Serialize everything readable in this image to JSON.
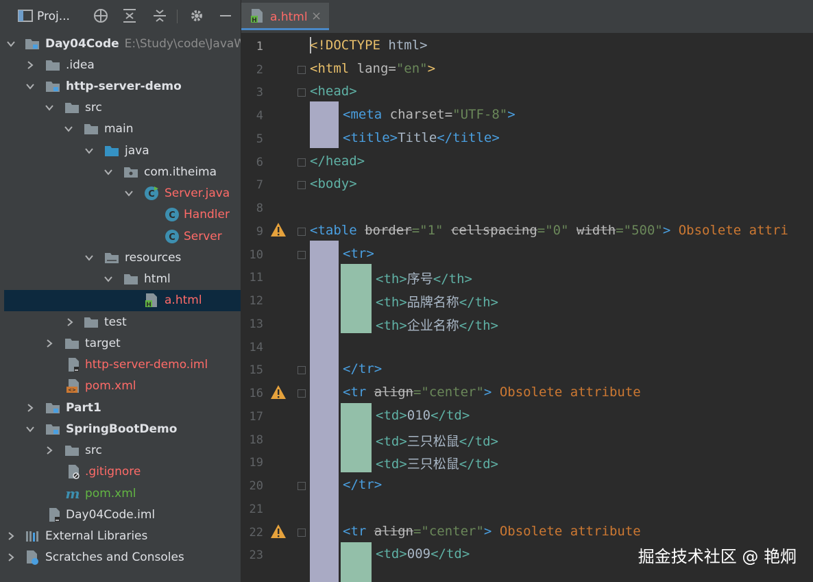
{
  "project_panel": {
    "title": "Proj...",
    "tree": [
      {
        "label": "Day04Code",
        "path": "E:\\Study\\code\\JavaWe",
        "icon": "module-folder-icon"
      },
      {
        "label": ".idea",
        "icon": "folder-icon"
      },
      {
        "label": "http-server-demo",
        "icon": "module-folder-icon"
      },
      {
        "label": "src",
        "icon": "folder-icon"
      },
      {
        "label": "main",
        "icon": "folder-icon"
      },
      {
        "label": "java",
        "icon": "source-folder-icon"
      },
      {
        "label": "com.itheima",
        "icon": "package-icon"
      },
      {
        "label": "Server.java",
        "icon": "java-class-icon"
      },
      {
        "label": "Handler",
        "icon": "class-icon"
      },
      {
        "label": "Server",
        "icon": "class-icon"
      },
      {
        "label": "resources",
        "icon": "folder-icon"
      },
      {
        "label": "html",
        "icon": "folder-icon"
      },
      {
        "label": "a.html",
        "icon": "html-file-icon"
      },
      {
        "label": "test",
        "icon": "folder-icon"
      },
      {
        "label": "target",
        "icon": "folder-icon"
      },
      {
        "label": "http-server-demo.iml",
        "icon": "iml-file-icon"
      },
      {
        "label": "pom.xml",
        "icon": "xml-file-icon"
      },
      {
        "label": "Part1",
        "icon": "module-folder-icon"
      },
      {
        "label": "SpringBootDemo",
        "icon": "module-folder-icon"
      },
      {
        "label": "src",
        "icon": "folder-icon"
      },
      {
        "label": ".gitignore",
        "icon": "gitignore-file-icon"
      },
      {
        "label": "pom.xml",
        "icon": "maven-icon"
      },
      {
        "label": "Day04Code.iml",
        "icon": "iml-file-icon"
      },
      {
        "label": "External Libraries",
        "icon": "libraries-icon"
      },
      {
        "label": "Scratches and Consoles",
        "icon": "scratches-icon"
      }
    ]
  },
  "editor_tab": {
    "label": "a.html",
    "close": "×"
  },
  "code_lines": [
    {
      "num": "1"
    },
    {
      "num": "2"
    },
    {
      "num": "3"
    },
    {
      "num": "4"
    },
    {
      "num": "5"
    },
    {
      "num": "6"
    },
    {
      "num": "7"
    },
    {
      "num": "8"
    },
    {
      "num": "9"
    },
    {
      "num": "10"
    },
    {
      "num": "11"
    },
    {
      "num": "12"
    },
    {
      "num": "13"
    },
    {
      "num": "14"
    },
    {
      "num": "15"
    },
    {
      "num": "16"
    },
    {
      "num": "17"
    },
    {
      "num": "18"
    },
    {
      "num": "19"
    },
    {
      "num": "20"
    },
    {
      "num": "21"
    },
    {
      "num": "22"
    },
    {
      "num": "23"
    }
  ],
  "code": {
    "l1_doctype": "<!DOCTYPE",
    "l1_rest": " html>",
    "l2_open": "<html ",
    "l2_attr": "lang=",
    "l2_val": "\"en\"",
    "l2_close": ">",
    "l3": "<head>",
    "l4_open": "<meta ",
    "l4_attr": "charset=",
    "l4_val": "\"UTF-8\"",
    "l4_close": ">",
    "l5_open": "<title>",
    "l5_text": "Title",
    "l5_close": "</title>",
    "l6": "</head>",
    "l7": "<body>",
    "l9_open": "<table ",
    "l9_a1": "border",
    "l9_v1": "=\"1\"",
    "l9_a2": "cellspacing",
    "l9_v2": "=\"0\"",
    "l9_a3": "width",
    "l9_v3": "=\"500\"",
    "l9_close": ">",
    "l9_warn": " Obsolete attri",
    "l10": "<tr>",
    "l11_o": "<th>",
    "l11_t": "序号",
    "l11_c": "</th>",
    "l12_o": "<th>",
    "l12_t": "品牌名称",
    "l12_c": "</th>",
    "l13_o": "<th>",
    "l13_t": "企业名称",
    "l13_c": "</th>",
    "l15": "</tr>",
    "l16_open": "<tr ",
    "l16_attr": "align",
    "l16_val": "=\"center\"",
    "l16_close": ">",
    "l16_warn": " Obsolete attribute",
    "l17_o": "<td>",
    "l17_t": "010",
    "l17_c": "</td>",
    "l18_o": "<td>",
    "l18_t": "三只松鼠",
    "l18_c": "</td>",
    "l19_o": "<td>",
    "l19_t": "三只松鼠",
    "l19_c": "</td>",
    "l20": "</tr>",
    "l22_open": "<tr ",
    "l22_attr": "align",
    "l22_val": "=\"center\"",
    "l22_close": ">",
    "l22_warn": " Obsolete attribute",
    "l23_o": "<td>",
    "l23_t": "009",
    "l23_c": "</td>"
  },
  "watermark": "掘金技术社区 @ 艳炯",
  "colors": {
    "panel_bg": "#3c3f41",
    "editor_bg": "#2b2b2b",
    "selection": "#0d293e",
    "warning": "#e6a23c"
  }
}
